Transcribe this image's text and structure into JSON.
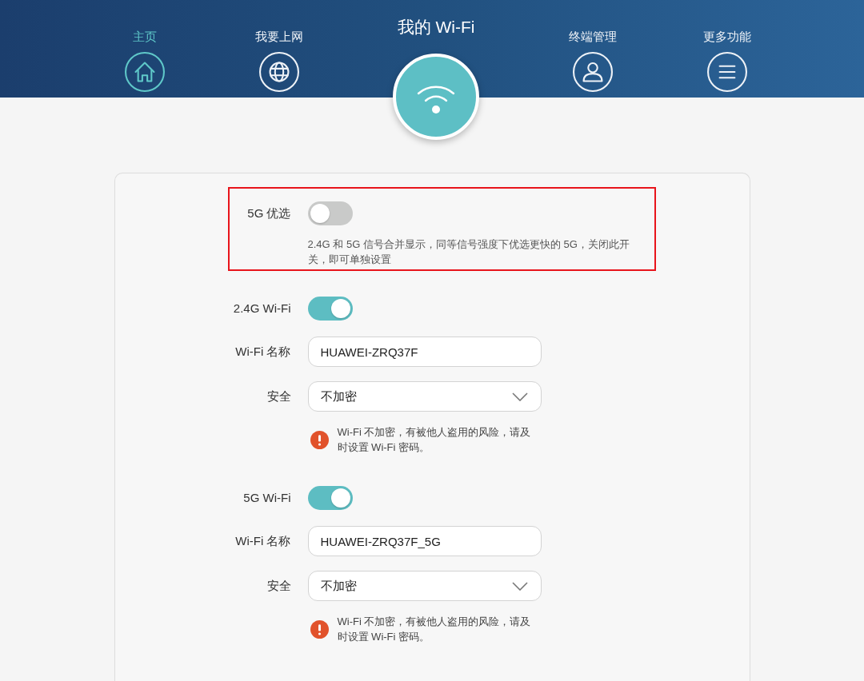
{
  "nav": {
    "items": [
      {
        "label": "主页",
        "kind": "home",
        "selected": true
      },
      {
        "label": "我要上网",
        "kind": "globe",
        "selected": false
      },
      {
        "label": "终端管理",
        "kind": "user",
        "selected": false
      },
      {
        "label": "更多功能",
        "kind": "menu",
        "selected": false
      }
    ],
    "current": {
      "title": "我的 Wi-Fi"
    }
  },
  "band_priority": {
    "label": "5G 优选",
    "on": false,
    "annotated": true,
    "description": "2.4G 和 5G 信号合并显示，同等信号强度下优选更快的 5G，关闭此开关，即可单独设置"
  },
  "bands": [
    {
      "label": "2.4G Wi-Fi",
      "on": true,
      "name_label": "Wi-Fi 名称",
      "name_value": "HUAWEI-ZRQ37F",
      "security_label": "安全",
      "security_value": "不加密",
      "warning": "Wi-Fi 不加密，有被他人盗用的风险，请及时设置 Wi-Fi 密码。"
    },
    {
      "label": "5G Wi-Fi",
      "on": true,
      "name_label": "Wi-Fi 名称",
      "name_value": "HUAWEI-ZRQ37F_5G",
      "security_label": "安全",
      "security_value": "不加密",
      "warning": "Wi-Fi 不加密，有被他人盗用的风险，请及时设置 Wi-Fi 密码。"
    }
  ]
}
